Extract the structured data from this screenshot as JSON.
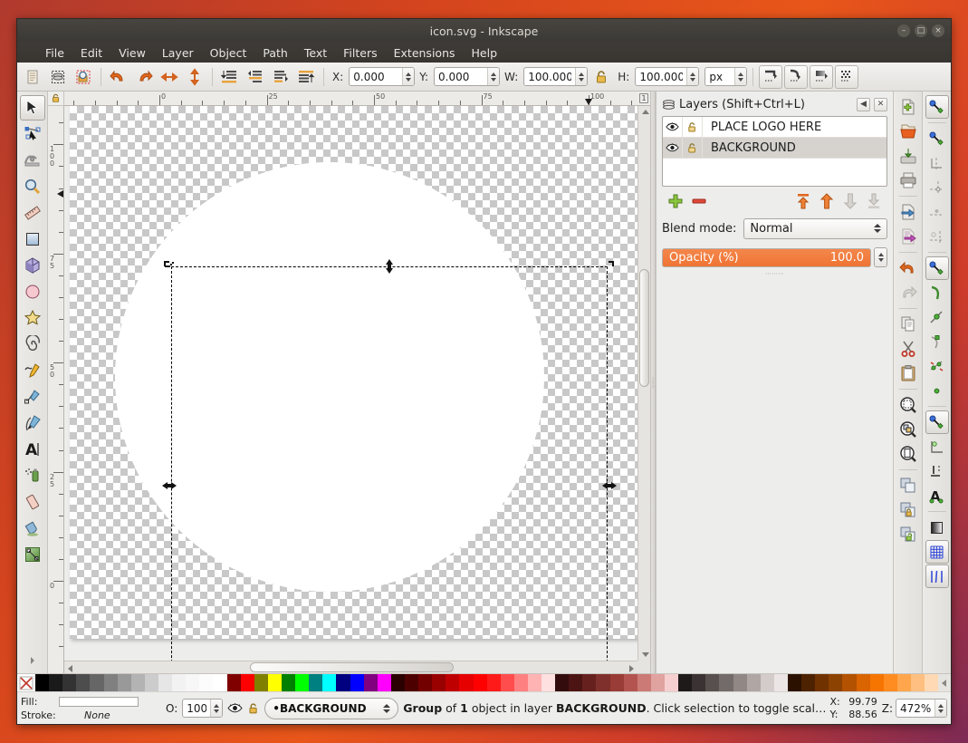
{
  "window": {
    "title": "icon.svg - Inkscape",
    "buttons": [
      {
        "name": "minimize-button",
        "glyph": "–"
      },
      {
        "name": "maximize-button",
        "glyph": "□"
      },
      {
        "name": "close-button",
        "glyph": "×"
      }
    ]
  },
  "menubar": {
    "items": [
      "File",
      "Edit",
      "View",
      "Layer",
      "Object",
      "Path",
      "Text",
      "Filters",
      "Extensions",
      "Help"
    ]
  },
  "toolbar": {
    "buttons": [
      {
        "name": "edit-document-properties-icon",
        "title": "Document properties"
      },
      {
        "name": "edit-xml-editor-icon",
        "title": "XML editor"
      },
      {
        "name": "edit-preferences-icon",
        "title": "Preferences"
      },
      {
        "name": "undo-icon",
        "title": "Undo"
      },
      {
        "name": "redo-icon",
        "title": "Redo"
      },
      {
        "name": "flip-horizontal-icon",
        "title": "Flip horizontal"
      },
      {
        "name": "flip-vertical-icon",
        "title": "Flip vertical"
      },
      {
        "name": "lower-to-bottom-icon",
        "title": "Lower to bottom"
      },
      {
        "name": "lower-icon",
        "title": "Lower"
      },
      {
        "name": "raise-icon",
        "title": "Raise"
      },
      {
        "name": "raise-to-top-icon",
        "title": "Raise to top"
      }
    ],
    "fields": {
      "x": {
        "label": "X:",
        "value": "0.000"
      },
      "y": {
        "label": "Y:",
        "value": "0.000"
      },
      "w": {
        "label": "W:",
        "value": "100.000"
      },
      "h": {
        "label": "H:",
        "value": "100.000"
      },
      "lock_icon": "lock-wh-ratio-icon",
      "unit": "px"
    },
    "right_buttons": [
      {
        "name": "affect-stroke-width-icon"
      },
      {
        "name": "affect-rounded-corners-icon"
      },
      {
        "name": "affect-gradients-icon"
      },
      {
        "name": "affect-patterns-icon"
      }
    ]
  },
  "toolbox": {
    "tools": [
      {
        "name": "selector-tool",
        "icon": "arrow-pointer-icon",
        "active": true
      },
      {
        "name": "node-tool",
        "icon": "node-editor-icon",
        "active": false
      },
      {
        "name": "tweak-tool",
        "icon": "tweak-icon",
        "active": false
      },
      {
        "name": "zoom-tool",
        "icon": "magnifier-icon",
        "active": false
      },
      {
        "name": "measure-tool",
        "icon": "ruler-icon",
        "active": false
      },
      {
        "name": "rectangle-tool",
        "icon": "square-icon",
        "active": false
      },
      {
        "name": "box3d-tool",
        "icon": "cube-icon",
        "active": false
      },
      {
        "name": "ellipse-tool",
        "icon": "circle-icon",
        "active": false
      },
      {
        "name": "star-tool",
        "icon": "star-icon",
        "active": false
      },
      {
        "name": "spiral-tool",
        "icon": "spiral-icon",
        "active": false
      },
      {
        "name": "pencil-tool",
        "icon": "pencil-icon",
        "active": false
      },
      {
        "name": "bezier-tool",
        "icon": "pen-icon",
        "active": false
      },
      {
        "name": "calligraphy-tool",
        "icon": "calligraphy-icon",
        "active": false
      },
      {
        "name": "text-tool",
        "icon": "letter-a-icon",
        "active": false
      },
      {
        "name": "spray-tool",
        "icon": "spray-can-icon",
        "active": false
      },
      {
        "name": "eraser-tool",
        "icon": "eraser-icon",
        "active": false
      },
      {
        "name": "paint-bucket-tool",
        "icon": "paint-bucket-icon",
        "active": false
      },
      {
        "name": "gradient-tool",
        "icon": "gradient-icon",
        "active": false
      }
    ]
  },
  "rulers": {
    "horizontal_labels": [
      "0",
      "25",
      "50",
      "75",
      "100"
    ],
    "vertical_labels": [
      "100",
      "75",
      "50",
      "25",
      "0"
    ],
    "unit_badge": "1"
  },
  "canvas": {
    "page_object": "white-circle",
    "selection": {
      "visible": true,
      "handles": 8,
      "handle_type": "scale-arrows"
    }
  },
  "layers_dock": {
    "title": "Layers (Shift+Ctrl+L)",
    "header_buttons": [
      {
        "name": "dock-collapse-icon",
        "glyph": "◀"
      },
      {
        "name": "dock-close-icon",
        "glyph": "✕"
      }
    ],
    "columns": [
      "visibility",
      "lock",
      "name"
    ],
    "layers": [
      {
        "name": "PLACE LOGO HERE",
        "visible": true,
        "locked": false,
        "selected": false
      },
      {
        "name": "BACKGROUND",
        "visible": true,
        "locked": false,
        "selected": true
      }
    ],
    "buttons": [
      {
        "name": "add-layer-button",
        "icon": "plus-icon"
      },
      {
        "name": "delete-layer-button",
        "icon": "minus-icon"
      },
      {
        "name": "layer-to-top-button",
        "icon": "arrow-to-top-icon",
        "enabled": true
      },
      {
        "name": "raise-layer-button",
        "icon": "arrow-up-icon",
        "enabled": true
      },
      {
        "name": "lower-layer-button",
        "icon": "arrow-down-icon",
        "enabled": false
      },
      {
        "name": "layer-to-bottom-button",
        "icon": "arrow-to-bottom-icon",
        "enabled": false
      }
    ],
    "blend_mode": {
      "label": "Blend mode:",
      "value": "Normal"
    },
    "opacity": {
      "label": "Opacity (%)",
      "value": "100.0",
      "percent": 100
    }
  },
  "command_bar_right": {
    "buttons": [
      {
        "name": "new-document-icon"
      },
      {
        "name": "open-document-icon"
      },
      {
        "name": "save-document-icon"
      },
      {
        "name": "print-document-icon"
      },
      {
        "name": "import-icon"
      },
      {
        "name": "export-icon"
      },
      {
        "name": "undo-icon"
      },
      {
        "name": "redo-icon"
      },
      {
        "name": "copy-icon"
      },
      {
        "name": "cut-icon"
      },
      {
        "name": "paste-icon"
      },
      {
        "name": "zoom-selection-icon"
      },
      {
        "name": "zoom-drawing-icon"
      },
      {
        "name": "zoom-page-icon"
      },
      {
        "name": "duplicate-icon"
      },
      {
        "name": "group-icon"
      },
      {
        "name": "ungroup-icon"
      }
    ]
  },
  "snap_bar_right": {
    "buttons": [
      {
        "name": "enable-snapping-icon",
        "active": true
      },
      {
        "name": "snap-bounding-box-icon",
        "active": false
      },
      {
        "name": "snap-bbox-edges-icon",
        "active": false
      },
      {
        "name": "snap-bbox-corners-icon",
        "active": false
      },
      {
        "name": "snap-bbox-edge-midpoints-icon",
        "active": false
      },
      {
        "name": "snap-bbox-centers-icon",
        "active": false
      },
      {
        "name": "snap-nodes-icon",
        "active": true
      },
      {
        "name": "snap-paths-icon",
        "active": false
      },
      {
        "name": "snap-path-intersections-icon",
        "active": false
      },
      {
        "name": "snap-to-nodes-icon",
        "active": false
      },
      {
        "name": "snap-smooth-nodes-icon",
        "active": false
      },
      {
        "name": "snap-midpoints-icon",
        "active": false
      },
      {
        "name": "snap-object-centers-icon",
        "active": true
      },
      {
        "name": "snap-rotation-centers-icon",
        "active": false
      },
      {
        "name": "snap-text-baseline-icon",
        "active": false
      },
      {
        "name": "snap-page-border-icon",
        "active": false
      },
      {
        "name": "snap-grid-icon",
        "active": true
      },
      {
        "name": "snap-guides-icon",
        "active": true
      }
    ]
  },
  "palette": {
    "none_swatch": "X",
    "colors": [
      "#000000",
      "#1a1a1a",
      "#333333",
      "#4d4d4d",
      "#666666",
      "#808080",
      "#999999",
      "#b3b3b3",
      "#cccccc",
      "#e6e6e6",
      "#f2f2f2",
      "#f7f7f7",
      "#fcfcfc",
      "#ffffff",
      "#800000",
      "#ff0000",
      "#808000",
      "#ffff00",
      "#008000",
      "#00ff00",
      "#008080",
      "#00ffff",
      "#000080",
      "#0000ff",
      "#800080",
      "#ff00ff",
      "#2b0000",
      "#4d0000",
      "#730000",
      "#990000",
      "#bf0000",
      "#e60000",
      "#ff0000",
      "#ff1a1a",
      "#ff4d4d",
      "#ff8080",
      "#ffb3b3",
      "#ffe0e0",
      "#330d0d",
      "#4d1414",
      "#66211f",
      "#80302c",
      "#993b36",
      "#b35450",
      "#cc7a75",
      "#e0a3a0",
      "#f5cfcf",
      "#1f1a1a",
      "#3b3333",
      "#57504e",
      "#736b69",
      "#918785",
      "#b0a6a4",
      "#d4cbcb",
      "#ece5e5",
      "#2b1200",
      "#4d2200",
      "#703300",
      "#8c4200",
      "#b35200",
      "#d96400",
      "#f57500",
      "#ff8c21",
      "#ffa64d",
      "#ffbf80",
      "#ffd9b3"
    ],
    "scroll_arrow": "scroll-left-icon"
  },
  "statusbar": {
    "fill_label": "Fill:",
    "fill_value": "#ffffff",
    "stroke_label": "Stroke:",
    "stroke_value": "None",
    "opacity_label": "O:",
    "opacity_value": "100",
    "layer_visibility_icon": "eye-icon",
    "layer_lock_icon": "unlock-icon",
    "current_layer": "•BACKGROUND",
    "message_plain_1": "Group",
    "message_plain_2": " of ",
    "message_plain_3": "1",
    "message_plain_4": " object in layer ",
    "message_plain_5": "BACKGROUND",
    "message_plain_6": ". Click selection to toggle scal…",
    "coord_x_label": "X:",
    "coord_x_value": "99.79",
    "coord_y_label": "Y:",
    "coord_y_value": "88.56",
    "zoom_label": "Z:",
    "zoom_value": "472%"
  }
}
